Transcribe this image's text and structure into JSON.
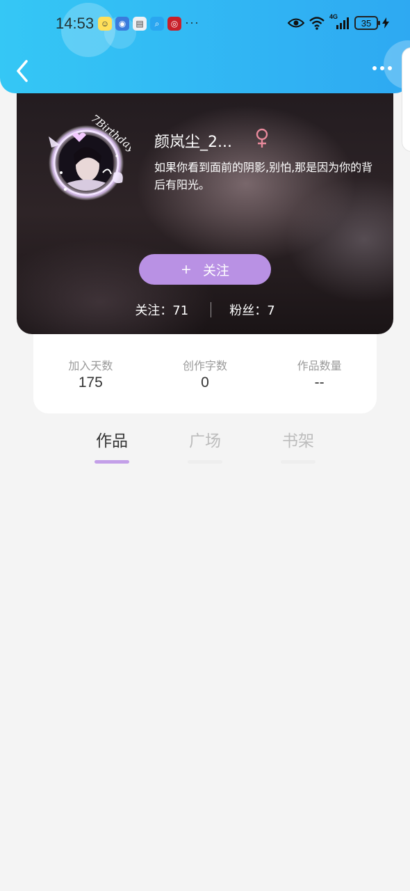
{
  "status_bar": {
    "time": "14:53",
    "notification_icons": [
      "baidu-app-icon",
      "security-app-icon",
      "notes-app-icon",
      "search-app-icon",
      "weibo-app-icon"
    ],
    "overflow": "···",
    "network": "4G",
    "battery": "35"
  },
  "header": {
    "back_icon": "chevron-left-icon",
    "more_icon": "more-dots-icon",
    "color_start": "#35c7f5",
    "color_end": "#2ea9f2"
  },
  "profile": {
    "avatar_frame_text": "7Birthday",
    "nickname": "颜岚尘_2...",
    "gender": "female",
    "gender_symbol": "♀",
    "bio": "如果你看到面前的阴影,别怕,那是因为你的背后有阳光。",
    "follow_plus": "+",
    "follow_label": "关注",
    "following": "关注：71",
    "followers": "粉丝：7",
    "accent": "#b991e4"
  },
  "stats": [
    {
      "label": "加入天数",
      "value": "175"
    },
    {
      "label": "创作字数",
      "value": "0"
    },
    {
      "label": "作品数量",
      "value": "--"
    }
  ],
  "tabs": [
    {
      "label": "作品",
      "active": true
    },
    {
      "label": "广场",
      "active": false
    },
    {
      "label": "书架",
      "active": false
    }
  ]
}
